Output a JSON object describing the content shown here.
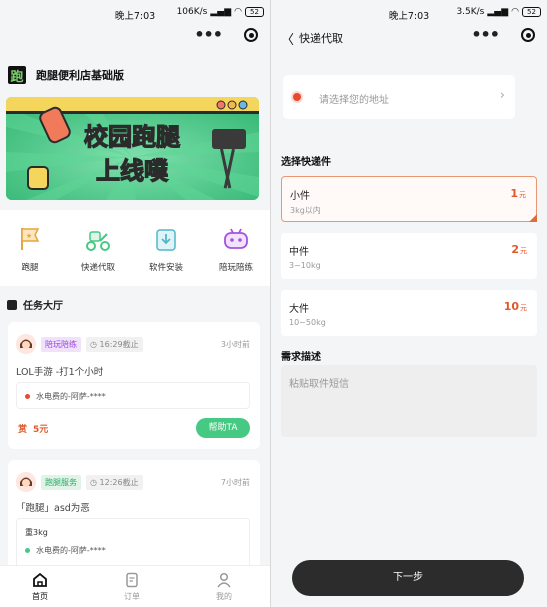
{
  "left": {
    "status": {
      "time": "晚上7:03",
      "net_speed": "106K/s",
      "battery": "52"
    },
    "brand": {
      "logo_char": "跑",
      "name": "跑腿便利店基础版"
    },
    "banner": {
      "title_line1": "校园跑腿",
      "title_line2": "上线噗"
    },
    "quick_actions": [
      {
        "label": "跑腿",
        "icon": "flag-icon"
      },
      {
        "label": "快递代取",
        "icon": "scooter-icon"
      },
      {
        "label": "软件安装",
        "icon": "download-icon"
      },
      {
        "label": "陪玩陪练",
        "icon": "gamepad-icon"
      }
    ],
    "task_hall": {
      "title": "任务大厅"
    },
    "tasks": [
      {
        "tag": "陪玩陪练",
        "deadline": "16:29截止",
        "ago": "3小时前",
        "title": "LOL手游 -打1个小时",
        "address": "水电费的-阿萨-****",
        "price_prefix": "赏",
        "price": "5元",
        "help_label": "帮助TA"
      },
      {
        "tag": "跑腿服务",
        "deadline": "12:26截止",
        "ago": "7小时前",
        "title": "「跑腿」asd为恶",
        "weight": "重3kg",
        "address": "水电费的-阿萨-****"
      }
    ],
    "tabbar": [
      {
        "label": "首页",
        "icon": "home-icon",
        "active": true
      },
      {
        "label": "订单",
        "icon": "order-icon",
        "active": false
      },
      {
        "label": "我的",
        "icon": "user-icon",
        "active": false
      }
    ]
  },
  "right": {
    "status": {
      "time": "晚上7:03",
      "net_speed": "3.5K/s",
      "battery": "52"
    },
    "nav": {
      "title": "快递代取"
    },
    "address": {
      "placeholder": "请选择您的地址"
    },
    "section_type": "选择快递件",
    "options": [
      {
        "name": "小件",
        "desc": "3kg以内",
        "price": "1",
        "unit": "元",
        "selected": true
      },
      {
        "name": "中件",
        "desc": "3~10kg",
        "price": "2",
        "unit": "元",
        "selected": false
      },
      {
        "name": "大件",
        "desc": "10~50kg",
        "price": "10",
        "unit": "元",
        "selected": false
      }
    ],
    "section_desc": "需求描述",
    "desc_placeholder": "粘贴取件短信",
    "next_label": "下一步"
  },
  "colors": {
    "brand_green": "#46c983",
    "accent_orange": "#e0572b",
    "dark_button": "#2c2c2c"
  }
}
